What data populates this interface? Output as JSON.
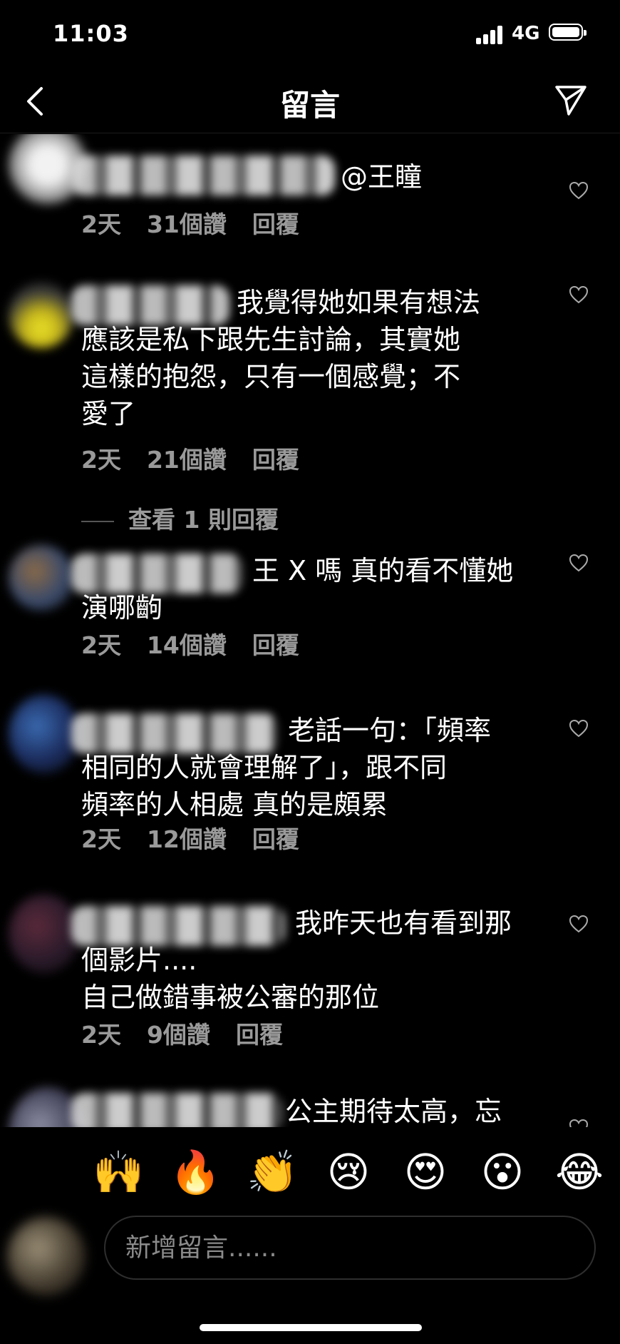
{
  "status_bar": {
    "time": "11:03",
    "network": "4G"
  },
  "header": {
    "title": "留言"
  },
  "comments": [
    {
      "text": "@王瞳",
      "time": "2天",
      "likes": "31個讚",
      "reply": "回覆"
    },
    {
      "text": "我覺得她如果有想法\n應該是私下跟先生討論，其實她\n這樣的抱怨，只有一個感覺；不\n愛了",
      "time": "2天",
      "likes": "21個讚",
      "reply": "回覆",
      "view_replies": "查看 1 則回覆"
    },
    {
      "text": "王 X 嗎 真的看不懂她\n演哪齣",
      "time": "2天",
      "likes": "14個讚",
      "reply": "回覆"
    },
    {
      "text": "老話一句：「頻率\n相同的人就會理解了」，跟不同\n頻率的人相處 真的是頗累",
      "time": "2天",
      "likes": "12個讚",
      "reply": "回覆"
    },
    {
      "text": "我昨天也有看到那\n個影片....\n自己做錯事被公審的那位",
      "time": "2天",
      "likes": "9個讚",
      "reply": "回覆"
    },
    {
      "text": "公主期待太高，忘"
    }
  ],
  "emoji_bar": [
    "🙌",
    "🔥",
    "👏",
    "😢",
    "😍",
    "😮",
    "😂"
  ],
  "input": {
    "placeholder": "新增留言......"
  },
  "colors": {
    "background": "#000000",
    "text": "#ffffff",
    "secondary_text": "#9a9a9a"
  }
}
